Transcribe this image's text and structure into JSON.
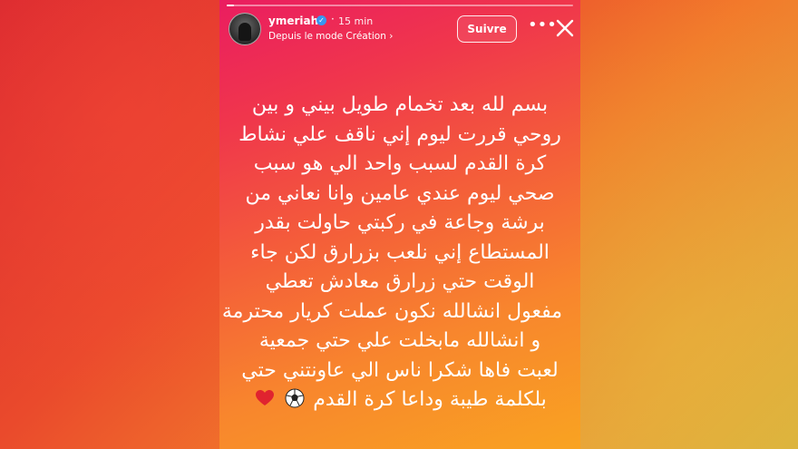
{
  "story": {
    "progress": 0.02,
    "username": "ymeriah",
    "time": "15 min",
    "subtitle": "Depuis le mode Création",
    "follow_label": "Suivre",
    "more_icon": "more-horizontal-icon",
    "close_icon": "close-icon",
    "text_lines": [
      "بسم لله بعد تخمام طويل بيني و بين",
      "روحي قررت ليوم إني ناقف علي نشاط",
      "كرة القدم لسبب واحد الي هو سبب",
      "صحي ليوم عندي عامين وانا نعاني من",
      "برشة وجاعة في ركبتي حاولت بقدر",
      "المستطاع إني نلعب بزرارق لكن جاء",
      "الوقت حتي زرارق معادش تعطي",
      "مفعول انشالله نكون عملت كريار محترمة",
      "و انشالله مابخلت علي حتي جمعية",
      "لعبت فاها شكرا ناس الي عاونتني حتي",
      "بلكلمة طيبة وداعا كرة القدم"
    ],
    "emojis": [
      "soccer-ball-icon",
      "red-heart-icon"
    ]
  }
}
